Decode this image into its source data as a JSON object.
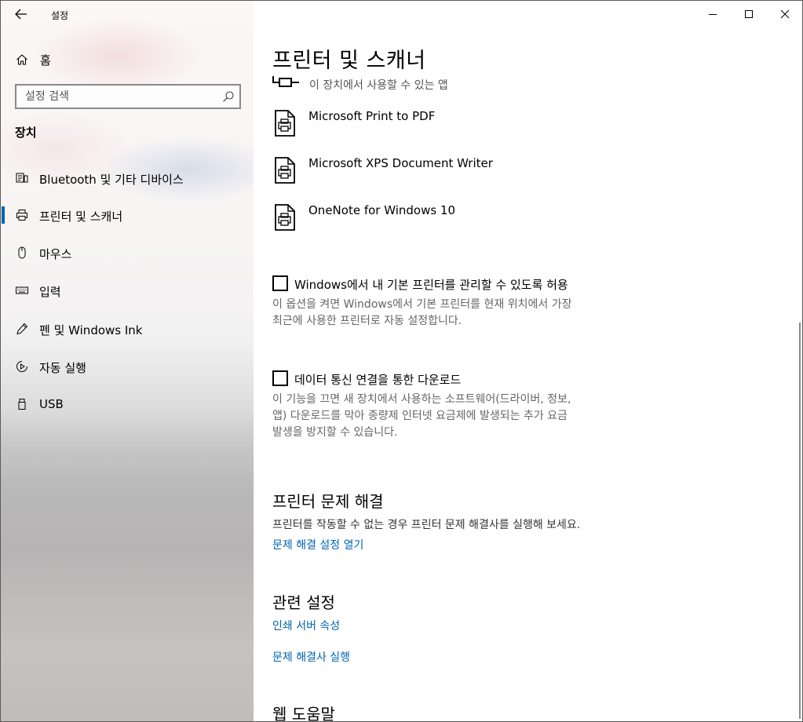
{
  "window": {
    "title": "설정",
    "controls": [
      "minimize",
      "maximize",
      "close"
    ]
  },
  "sidebar": {
    "home_label": "홈",
    "search_placeholder": "설정 검색",
    "section_title": "장치",
    "items": [
      {
        "label": "Bluetooth 및 기타 디바이스",
        "icon": "bluetooth-devices-icon"
      },
      {
        "label": "프린터 및 스캐너",
        "icon": "printer-icon",
        "active": true
      },
      {
        "label": "마우스",
        "icon": "mouse-icon"
      },
      {
        "label": "입력",
        "icon": "keyboard-icon"
      },
      {
        "label": "펜 및 Windows Ink",
        "icon": "pen-icon"
      },
      {
        "label": "자동 실행",
        "icon": "autoplay-icon"
      },
      {
        "label": "USB",
        "icon": "usb-icon"
      }
    ]
  },
  "main": {
    "title": "프린터 및 스캐너",
    "partial_row_label": "이 장치에서 사용할 수 있는 앱",
    "printers": [
      {
        "label": "Microsoft Print to PDF"
      },
      {
        "label": "Microsoft XPS Document Writer"
      },
      {
        "label": "OneNote for Windows 10"
      }
    ],
    "default_printer": {
      "label": "Windows에서 내 기본 프린터를 관리할 수 있도록 허용",
      "checked": false,
      "desc_line1": "이 옵션을 켜면 Windows에서 기본 프린터를 현재 위치에서 가장",
      "desc_line2": "최근에 사용한 프린터로 자동 설정합니다."
    },
    "metered": {
      "label": "데이터 통신 연결을 통한 다운로드",
      "checked": false,
      "desc_line1": "이 기능을 끄면 새 장치에서 사용하는 소프트웨어(드라이버, 정보,",
      "desc_line2": "앱) 다운로드를 막아 종량제 인터넷 요금제에 발생되는 추가 요금",
      "desc_line3": "발생을 방지할 수 있습니다."
    },
    "troubleshoot": {
      "heading": "프린터 문제 해결",
      "text": "프린터를 작동할 수 없는 경우 프린터 문제 해결사를 실행해 보세요.",
      "link": "문제 해결 설정 열기"
    },
    "related": {
      "heading": "관련 설정",
      "links": [
        "인쇄 서버 속성",
        "문제 해결사 실행"
      ]
    },
    "web_help": {
      "heading": "웹 도움말"
    }
  },
  "colors": {
    "accent": "#0063b1",
    "secondary_text": "#666666"
  }
}
